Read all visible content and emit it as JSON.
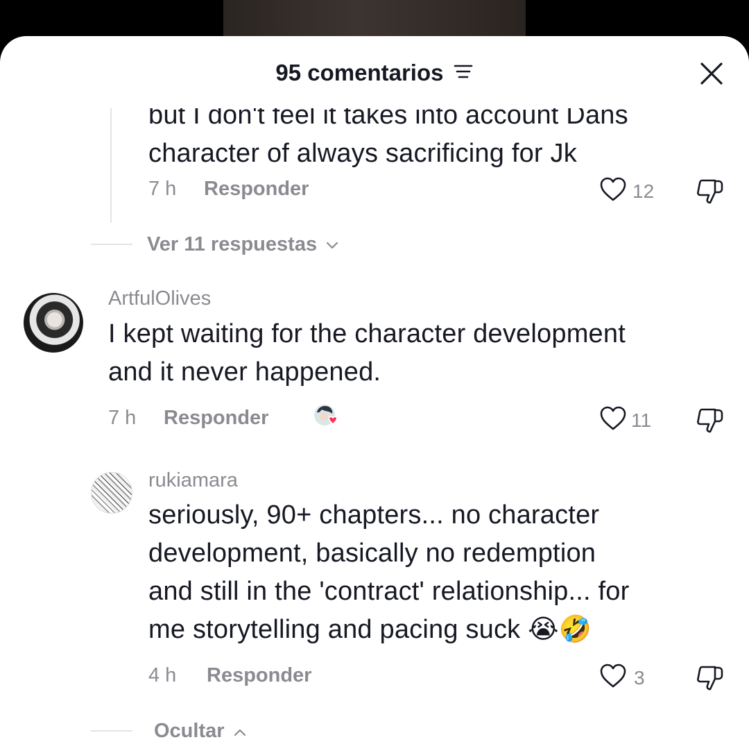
{
  "header": {
    "title": "95 comentarios",
    "sort_icon": "sort-lines-icon",
    "close_icon": "close-icon"
  },
  "comments": [
    {
      "text_line1": "but I don't feel it takes into account Dans",
      "text_line2": "character of always sacrificing for Jk",
      "time": "7 h",
      "reply_label": "Responder",
      "likes": "12"
    },
    {
      "username": "ArtfulOlives",
      "text_line1": "I kept waiting for the character development",
      "text_line2": "and it never happened.",
      "time": "7 h",
      "reply_label": "Responder",
      "likes": "11"
    },
    {
      "username": "rukiamara",
      "text_line1": "seriously, 90+ chapters... no character",
      "text_line2": "development, basically no redemption",
      "text_line3": "and still in the 'contract' relationship... for",
      "text_line4": "me storytelling and pacing suck 😭🤣",
      "time": "4 h",
      "reply_label": "Responder",
      "likes": "3"
    }
  ],
  "view_replies": "Ver 11 respuestas",
  "hide_label": "Ocultar",
  "colors": {
    "text": "#161823",
    "muted": "#8a8b91",
    "heart_badge": "#fe2c55"
  }
}
